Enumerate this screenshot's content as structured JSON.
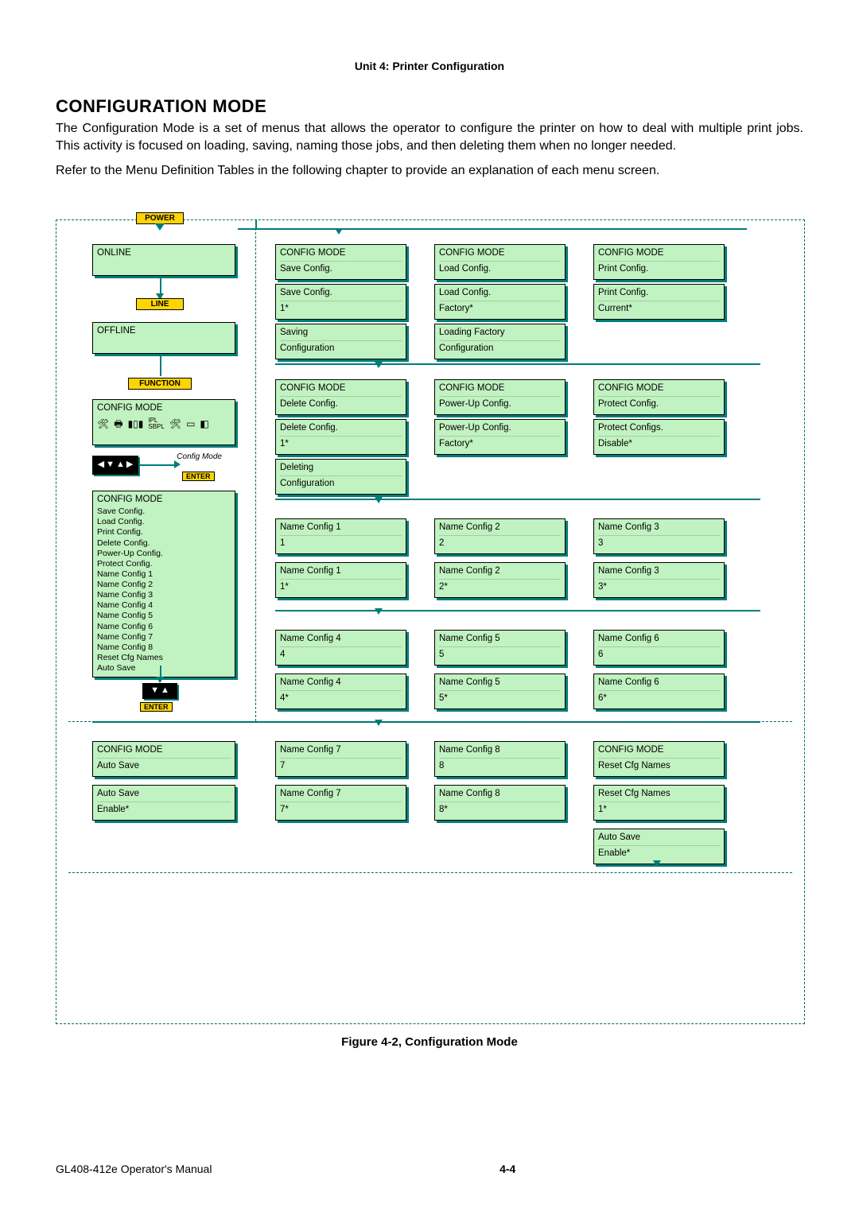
{
  "header": {
    "unit": "Unit 4:  Printer Configuration"
  },
  "section": {
    "title": "CONFIGURATION MODE",
    "para1": "The Configuration Mode is a set of menus that allows the operator to configure the printer on how to deal with multiple print jobs. This activity is focused on loading, saving, naming those jobs, and then deleting them when no longer needed.",
    "para2": "Refer to the Menu Definition Tables in the following chapter to provide an explanation of each menu screen."
  },
  "keys": {
    "power": "POWER",
    "line": "LINE",
    "function": "FUNCTION",
    "enter": "ENTER",
    "config_mode": "Config Mode"
  },
  "left": {
    "online": "ONLINE",
    "offline": "OFFLINE",
    "configmode_title": "CONFIG MODE",
    "menulist_title": "CONFIG MODE",
    "menulist": [
      "Save Config.",
      "Load Config.",
      "Print Config.",
      "Delete Config.",
      "Power-Up Config.",
      "Protect Config.",
      "Name Config 1",
      "Name Config 2",
      "Name Config 3",
      "Name Config 4",
      "Name Config 5",
      "Name Config 6",
      "Name Config 7",
      "Name Config 8",
      "Reset Cfg Names",
      "Auto Save"
    ],
    "navpad": "◀▼▲▶"
  },
  "rows": {
    "r1": {
      "a": [
        "CONFIG MODE",
        "Save Config."
      ],
      "b": [
        "CONFIG MODE",
        "Load Config."
      ],
      "c": [
        "CONFIG MODE",
        "Print Config."
      ]
    },
    "r1b": {
      "a": [
        "Save Config.",
        "1*"
      ],
      "b": [
        "Load Config.",
        "Factory*"
      ],
      "c": [
        "Print Config.",
        "Current*"
      ]
    },
    "r1c": {
      "a": [
        "Saving",
        "Configuration"
      ],
      "b": [
        "Loading Factory",
        "Configuration"
      ]
    },
    "r2": {
      "a": [
        "CONFIG MODE",
        "Delete Config."
      ],
      "b": [
        "CONFIG MODE",
        "Power-Up Config."
      ],
      "c": [
        "CONFIG MODE",
        "Protect Config."
      ]
    },
    "r2b": {
      "a": [
        "Delete Config.",
        "1*"
      ],
      "b": [
        "Power-Up Config.",
        "Factory*"
      ],
      "c": [
        "Protect Configs.",
        "Disable*"
      ]
    },
    "r2c": {
      "a": [
        "Deleting",
        "Configuration"
      ]
    },
    "r3": {
      "a": [
        "Name Config 1",
        "1"
      ],
      "b": [
        "Name Config 2",
        "2"
      ],
      "c": [
        "Name Config 3",
        "3"
      ]
    },
    "r3b": {
      "a": [
        "Name Config 1",
        "1*"
      ],
      "b": [
        "Name Config 2",
        "2*"
      ],
      "c": [
        "Name Config 3",
        "3*"
      ]
    },
    "r4": {
      "a": [
        "Name Config 4",
        "4"
      ],
      "b": [
        "Name Config 5",
        "5"
      ],
      "c": [
        "Name Config 6",
        "6"
      ]
    },
    "r4b": {
      "a": [
        "Name Config 4",
        "4*"
      ],
      "b": [
        "Name Config 5",
        "5*"
      ],
      "c": [
        "Name Config 6",
        "6*"
      ]
    },
    "r5": {
      "a0": [
        "CONFIG MODE",
        "Auto Save"
      ],
      "a": [
        "Name Config 7",
        "7"
      ],
      "b": [
        "Name Config 8",
        "8"
      ],
      "c": [
        "CONFIG MODE",
        "Reset Cfg Names"
      ]
    },
    "r5b": {
      "a0": [
        "Auto Save",
        "Enable*"
      ],
      "a": [
        "Name Config 7",
        "7*"
      ],
      "b": [
        "Name Config 8",
        "8*"
      ],
      "c": [
        "Reset Cfg Names",
        "1*"
      ]
    },
    "r5c": {
      "c": [
        "Auto Save",
        "Enable*"
      ]
    }
  },
  "caption": "Figure 4-2, Configuration Mode",
  "footer": {
    "manual": "GL408-412e Operator's Manual",
    "page": "4-4"
  }
}
